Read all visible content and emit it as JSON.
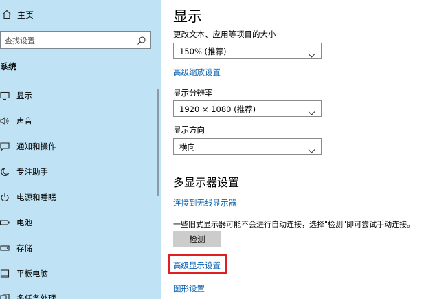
{
  "sidebar": {
    "home_label": "主页",
    "search_placeholder": "查找设置",
    "section_title": "系统",
    "items": [
      {
        "label": "显示",
        "icon": "monitor-icon"
      },
      {
        "label": "声音",
        "icon": "speaker-icon"
      },
      {
        "label": "通知和操作",
        "icon": "notification-icon"
      },
      {
        "label": "专注助手",
        "icon": "moon-icon"
      },
      {
        "label": "电源和睡眠",
        "icon": "power-icon"
      },
      {
        "label": "电池",
        "icon": "battery-icon"
      },
      {
        "label": "存储",
        "icon": "storage-icon"
      },
      {
        "label": "平板电脑",
        "icon": "tablet-icon"
      },
      {
        "label": "多任务处理",
        "icon": "multitask-icon"
      }
    ]
  },
  "main": {
    "title": "显示",
    "scale_label": "更改文本、应用等项目的大小",
    "scale_value": "150% (推荐)",
    "advanced_scaling_link": "高级缩放设置",
    "resolution_label": "显示分辨率",
    "resolution_value": "1920 × 1080 (推荐)",
    "orientation_label": "显示方向",
    "orientation_value": "横向",
    "multi_display_heading": "多显示器设置",
    "wireless_link": "连接到无线显示器",
    "detect_description": "一些旧式显示器可能不会进行自动连接，选择\"检测\"即可尝试手动连接。",
    "detect_button": "检测",
    "advanced_display_link": "高级显示设置",
    "graphics_link": "图形设置"
  },
  "colors": {
    "sidebar_bg": "#bfe3f4",
    "link": "#0a64b4",
    "highlight_border": "#e02020",
    "button_bg": "#cccccc"
  }
}
